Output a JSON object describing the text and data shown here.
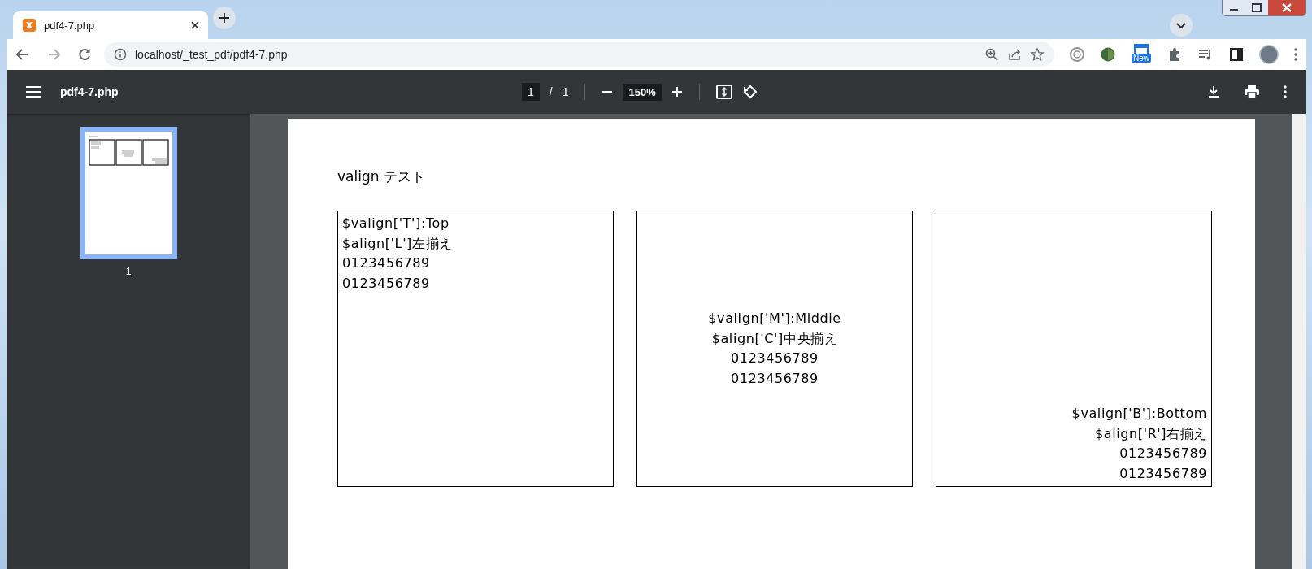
{
  "browser": {
    "tabs": [
      {
        "title": "pdf4-7.php",
        "selected": true
      }
    ],
    "address": "localhost/_test_pdf/pdf4-7.php",
    "extension_badge": "New"
  },
  "pdf_toolbar": {
    "title": "pdf4-7.php",
    "page_input": "1",
    "page_separator": "/",
    "page_count": "1",
    "zoom": "150%"
  },
  "sidebar": {
    "thumbnails": [
      {
        "label": "1",
        "selected": true
      }
    ]
  },
  "page": {
    "heading": "valign テスト",
    "cells": [
      {
        "kind": "top-left",
        "lines": [
          "$valign['T']:Top",
          "$align['L']左揃え",
          "0123456789",
          "0123456789"
        ]
      },
      {
        "kind": "middle-center",
        "lines": [
          "$valign['M']:Middle",
          "$align['C']中央揃え",
          "0123456789",
          "0123456789"
        ]
      },
      {
        "kind": "bottom-right",
        "lines": [
          "$valign['B']:Bottom",
          "$align['R']右揃え",
          "0123456789",
          "0123456789"
        ]
      }
    ]
  }
}
